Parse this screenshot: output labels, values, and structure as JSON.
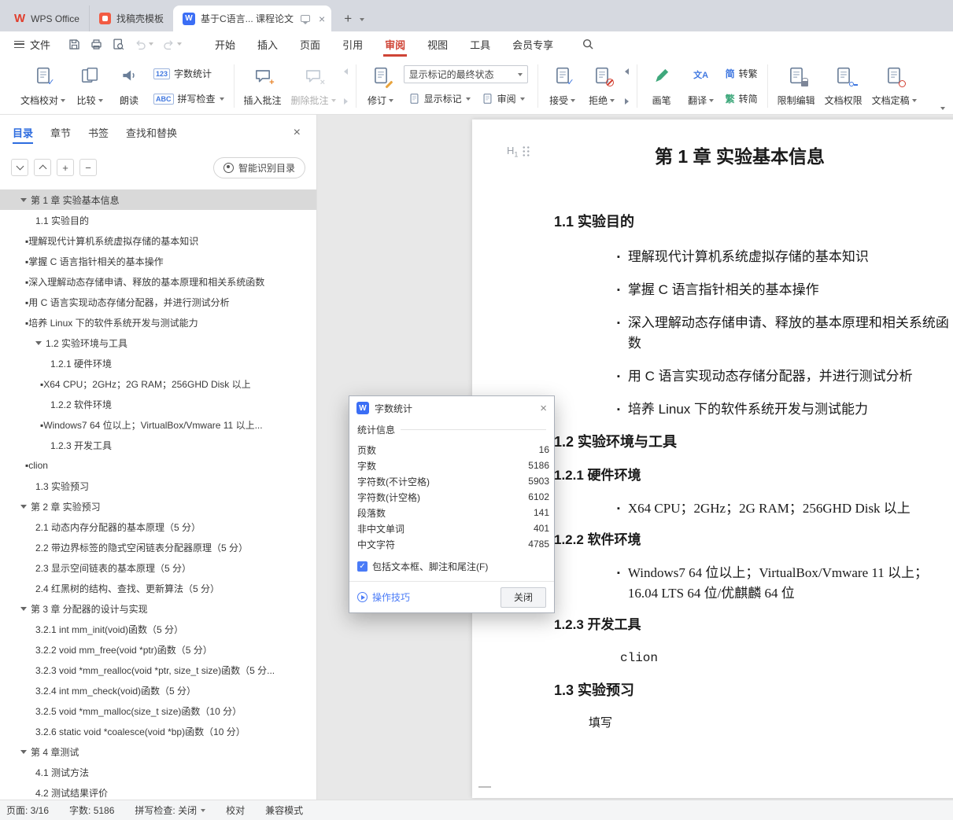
{
  "titlebar": {
    "tabs": [
      {
        "label": "WPS Office"
      },
      {
        "label": "找稿壳模板"
      },
      {
        "label": "基于C语言... 课程论文"
      }
    ]
  },
  "menubar": {
    "file": "文件",
    "tabs": [
      "开始",
      "插入",
      "页面",
      "引用",
      "审阅",
      "视图",
      "工具",
      "会员专享"
    ],
    "active_tab": "审阅"
  },
  "ribbon": {
    "doc_proof": "文档校对",
    "compare": "比较",
    "read_aloud": "朗读",
    "word_count": "字数统计",
    "word_count_icon": "123",
    "spell_check": "拼写检查",
    "spell_check_icon": "ABC",
    "insert_comment": "插入批注",
    "delete_comment": "删除批注",
    "revision": "修订",
    "markup_state": "显示标记的最终状态",
    "show_markup": "显示标记",
    "review": "审阅",
    "accept": "接受",
    "reject": "拒绝",
    "brush": "画笔",
    "translate": "翻译",
    "translate_icon": "文A",
    "to_traditional": "转繁",
    "to_simplified": "转简",
    "simp_char": "简",
    "trad_char": "繁",
    "restrict_edit": "限制编辑",
    "doc_permission": "文档权限",
    "doc_finalize": "文档定稿"
  },
  "sidebar": {
    "tabs": [
      "目录",
      "章节",
      "书签",
      "查找和替换"
    ],
    "active_tab": "目录",
    "smart_toc": "智能识别目录",
    "toc": [
      {
        "text": "第 1 章 实验基本信息",
        "level": 0,
        "arrow": true,
        "selected": true
      },
      {
        "text": "1.1 实验目的",
        "level": 1
      },
      {
        "text": "理解现代计算机系统虚拟存储的基本知识",
        "level": 1,
        "bullet": true
      },
      {
        "text": "掌握 C 语言指针相关的基本操作",
        "level": 1,
        "bullet": true
      },
      {
        "text": "深入理解动态存储申请、释放的基本原理和相关系统函数",
        "level": 1,
        "bullet": true
      },
      {
        "text": "用 C 语言实现动态存储分配器，并进行测试分析",
        "level": 1,
        "bullet": true
      },
      {
        "text": "培养 Linux 下的软件系统开发与测试能力",
        "level": 1,
        "bullet": true
      },
      {
        "text": "1.2 实验环境与工具",
        "level": 1,
        "arrow": true
      },
      {
        "text": "1.2.1 硬件环境",
        "level": 2
      },
      {
        "text": "X64 CPU；2GHz；2G RAM；256GHD Disk 以上",
        "level": 2,
        "bullet": true
      },
      {
        "text": "1.2.2 软件环境",
        "level": 2
      },
      {
        "text": "Windows7 64 位以上；VirtualBox/Vmware 11 以上...",
        "level": 2,
        "bullet": true
      },
      {
        "text": "1.2.3 开发工具",
        "level": 2
      },
      {
        "text": "clion",
        "level": 1,
        "bullet": true
      },
      {
        "text": "1.3 实验预习",
        "level": 1
      },
      {
        "text": "第 2 章 实验预习",
        "level": 0,
        "arrow": true
      },
      {
        "text": "2.1 动态内存分配器的基本原理（5 分）",
        "level": 1
      },
      {
        "text": "2.2 带边界标签的隐式空闲链表分配器原理（5 分）",
        "level": 1
      },
      {
        "text": "2.3 显示空间链表的基本原理（5 分）",
        "level": 1
      },
      {
        "text": "2.4 红黑树的结构、查找、更新算法（5 分）",
        "level": 1
      },
      {
        "text": "第 3 章 分配器的设计与实现",
        "level": 0,
        "arrow": true
      },
      {
        "text": "3.2.1 int mm_init(void)函数（5 分）",
        "level": 1
      },
      {
        "text": "3.2.2 void mm_free(void *ptr)函数（5 分）",
        "level": 1
      },
      {
        "text": "3.2.3 void *mm_realloc(void *ptr, size_t size)函数（5 分...",
        "level": 1
      },
      {
        "text": "3.2.4 int mm_check(void)函数（5 分）",
        "level": 1
      },
      {
        "text": "3.2.5 void *mm_malloc(size_t size)函数（10 分）",
        "level": 1
      },
      {
        "text": "3.2.6 static void *coalesce(void *bp)函数（10 分）",
        "level": 1
      },
      {
        "text": "第 4 章测试",
        "level": 0,
        "arrow": true
      },
      {
        "text": "4.1 测试方法",
        "level": 1
      },
      {
        "text": "4.2 测试结果评价",
        "level": 1
      }
    ]
  },
  "document": {
    "heading_handle_letter": "H",
    "heading_handle_level": "1",
    "blocks": [
      {
        "type": "h1",
        "text": "第 1 章 实验基本信息"
      },
      {
        "type": "h2",
        "text": "1.1 实验目的"
      },
      {
        "type": "bullet",
        "font": "sans",
        "text": "理解现代计算机系统虚拟存储的基本知识"
      },
      {
        "type": "bullet",
        "font": "sans",
        "text": "掌握 C 语言指针相关的基本操作"
      },
      {
        "type": "bullet",
        "font": "sans",
        "text": "深入理解动态存储申请、释放的基本原理和相关系统函数"
      },
      {
        "type": "bullet",
        "font": "sans",
        "text": "用 C 语言实现动态存储分配器，并进行测试分析"
      },
      {
        "type": "bullet",
        "font": "sans",
        "text": "培养 Linux 下的软件系统开发与测试能力"
      },
      {
        "type": "h2",
        "text": "1.2 实验环境与工具"
      },
      {
        "type": "h3",
        "text": "1.2.1 硬件环境"
      },
      {
        "type": "bullet",
        "font": "serif",
        "text": "X64 CPU；2GHz；2G RAM；256GHD Disk 以上"
      },
      {
        "type": "h3",
        "text": "1.2.2 软件环境"
      },
      {
        "type": "bullet",
        "font": "serif",
        "text": "Windows7 64 位以上；VirtualBox/Vmware 11 以上；16.04 LTS 64 位/优麒麟 64 位"
      },
      {
        "type": "h3",
        "text": "1.2.3 开发工具"
      },
      {
        "type": "code",
        "text": "clion"
      },
      {
        "type": "h2",
        "text": "1.3 实验预习"
      },
      {
        "type": "plain",
        "text": "填写"
      }
    ]
  },
  "dialog": {
    "title": "字数统计",
    "group_label": "统计信息",
    "stats": [
      {
        "label": "页数",
        "value": "16"
      },
      {
        "label": "字数",
        "value": "5186"
      },
      {
        "label": "字符数(不计空格)",
        "value": "5903"
      },
      {
        "label": "字符数(计空格)",
        "value": "6102"
      },
      {
        "label": "段落数",
        "value": "141"
      },
      {
        "label": "非中文单词",
        "value": "401"
      },
      {
        "label": "中文字符",
        "value": "4785"
      }
    ],
    "checkbox_label": "包括文本框、脚注和尾注(F)",
    "checkbox_checked": true,
    "tips_label": "操作技巧",
    "close_label": "关闭"
  },
  "statusbar": {
    "page": "页面: 3/16",
    "words": "字数: 5186",
    "spell": "拼写检查: 关闭",
    "proofread": "校对",
    "mode": "兼容模式"
  }
}
